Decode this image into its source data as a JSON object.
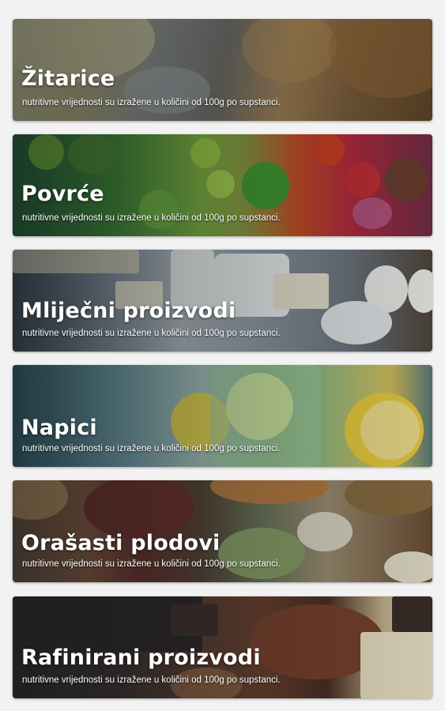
{
  "categories": [
    {
      "title": "Žitarice",
      "subtitle": "nutritivne vrijednosti su izražene u količini od 100g po supstanci."
    },
    {
      "title": "Povrće",
      "subtitle": "nutritivne vrijednosti su izražene u količini od 100g po supstanci."
    },
    {
      "title": "Mliječni proizvodi",
      "subtitle": "nutritivne vrijednosti su izražene u količini od 100g po supstanci."
    },
    {
      "title": "Napici",
      "subtitle": "nutritivne vrijednosti su izražene u količini od 100g po supstanci."
    },
    {
      "title": "Orašasti plodovi",
      "subtitle": "nutritivne vrijednosti su izražene u količini od 100g po supstanci."
    },
    {
      "title": "Rafinirani proizvodi",
      "subtitle": "nutritivne vrijednosti su izražene u količini od 100g po supstanci."
    }
  ],
  "colors": {
    "page_background": "#f2f2f2",
    "text": "#ffffff"
  }
}
